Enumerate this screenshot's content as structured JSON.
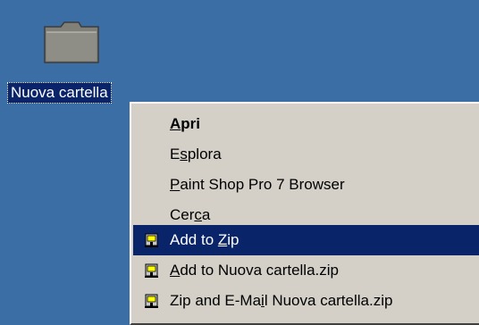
{
  "desktop": {
    "background_color": "#3a6ea5",
    "folder": {
      "icon": "folder-icon",
      "label": "Nuova cartella",
      "selected": true
    }
  },
  "context_menu": {
    "highlight_color": "#0a246a",
    "items": [
      {
        "label_pre": "",
        "mnemonic": "A",
        "label_post": "pri",
        "default": true,
        "icon": null
      },
      {
        "label_pre": "E",
        "mnemonic": "s",
        "label_post": "plora",
        "icon": null
      },
      {
        "label_pre": "",
        "mnemonic": "P",
        "label_post": "aint Shop Pro 7 Browser",
        "icon": null
      },
      {
        "label_pre": "Cer",
        "mnemonic": "c",
        "label_post": "a",
        "icon": null
      },
      {
        "label_pre": "Add to ",
        "mnemonic": "Z",
        "label_post": "ip",
        "highlighted": true,
        "icon": "winzip-icon"
      },
      {
        "label_pre": "",
        "mnemonic": "A",
        "label_post": "dd to Nuova cartella.zip",
        "icon": "winzip-icon"
      },
      {
        "label_pre": "Zip and E-Ma",
        "mnemonic": "i",
        "label_post": "l Nuova cartella.zip",
        "icon": "winzip-icon"
      }
    ]
  }
}
